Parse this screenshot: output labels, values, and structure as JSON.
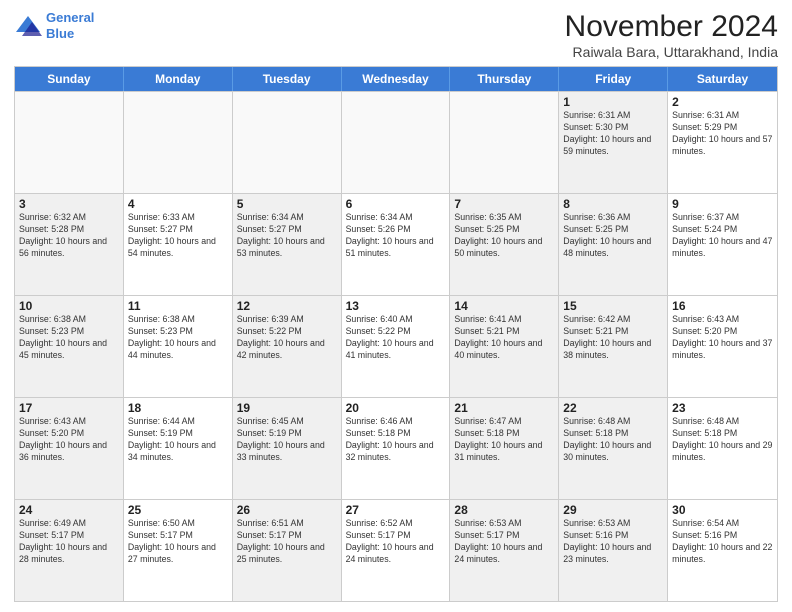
{
  "header": {
    "logo_line1": "General",
    "logo_line2": "Blue",
    "month_title": "November 2024",
    "location": "Raiwala Bara, Uttarakhand, India"
  },
  "weekdays": [
    "Sunday",
    "Monday",
    "Tuesday",
    "Wednesday",
    "Thursday",
    "Friday",
    "Saturday"
  ],
  "weeks": [
    [
      {
        "day": "",
        "info": "",
        "empty": true
      },
      {
        "day": "",
        "info": "",
        "empty": true
      },
      {
        "day": "",
        "info": "",
        "empty": true
      },
      {
        "day": "",
        "info": "",
        "empty": true
      },
      {
        "day": "",
        "info": "",
        "empty": true
      },
      {
        "day": "1",
        "info": "Sunrise: 6:31 AM\nSunset: 5:30 PM\nDaylight: 10 hours and 59 minutes.",
        "shaded": true
      },
      {
        "day": "2",
        "info": "Sunrise: 6:31 AM\nSunset: 5:29 PM\nDaylight: 10 hours and 57 minutes."
      }
    ],
    [
      {
        "day": "3",
        "info": "Sunrise: 6:32 AM\nSunset: 5:28 PM\nDaylight: 10 hours and 56 minutes.",
        "shaded": true
      },
      {
        "day": "4",
        "info": "Sunrise: 6:33 AM\nSunset: 5:27 PM\nDaylight: 10 hours and 54 minutes."
      },
      {
        "day": "5",
        "info": "Sunrise: 6:34 AM\nSunset: 5:27 PM\nDaylight: 10 hours and 53 minutes.",
        "shaded": true
      },
      {
        "day": "6",
        "info": "Sunrise: 6:34 AM\nSunset: 5:26 PM\nDaylight: 10 hours and 51 minutes."
      },
      {
        "day": "7",
        "info": "Sunrise: 6:35 AM\nSunset: 5:25 PM\nDaylight: 10 hours and 50 minutes.",
        "shaded": true
      },
      {
        "day": "8",
        "info": "Sunrise: 6:36 AM\nSunset: 5:25 PM\nDaylight: 10 hours and 48 minutes.",
        "shaded": true
      },
      {
        "day": "9",
        "info": "Sunrise: 6:37 AM\nSunset: 5:24 PM\nDaylight: 10 hours and 47 minutes."
      }
    ],
    [
      {
        "day": "10",
        "info": "Sunrise: 6:38 AM\nSunset: 5:23 PM\nDaylight: 10 hours and 45 minutes.",
        "shaded": true
      },
      {
        "day": "11",
        "info": "Sunrise: 6:38 AM\nSunset: 5:23 PM\nDaylight: 10 hours and 44 minutes."
      },
      {
        "day": "12",
        "info": "Sunrise: 6:39 AM\nSunset: 5:22 PM\nDaylight: 10 hours and 42 minutes.",
        "shaded": true
      },
      {
        "day": "13",
        "info": "Sunrise: 6:40 AM\nSunset: 5:22 PM\nDaylight: 10 hours and 41 minutes."
      },
      {
        "day": "14",
        "info": "Sunrise: 6:41 AM\nSunset: 5:21 PM\nDaylight: 10 hours and 40 minutes.",
        "shaded": true
      },
      {
        "day": "15",
        "info": "Sunrise: 6:42 AM\nSunset: 5:21 PM\nDaylight: 10 hours and 38 minutes.",
        "shaded": true
      },
      {
        "day": "16",
        "info": "Sunrise: 6:43 AM\nSunset: 5:20 PM\nDaylight: 10 hours and 37 minutes."
      }
    ],
    [
      {
        "day": "17",
        "info": "Sunrise: 6:43 AM\nSunset: 5:20 PM\nDaylight: 10 hours and 36 minutes.",
        "shaded": true
      },
      {
        "day": "18",
        "info": "Sunrise: 6:44 AM\nSunset: 5:19 PM\nDaylight: 10 hours and 34 minutes."
      },
      {
        "day": "19",
        "info": "Sunrise: 6:45 AM\nSunset: 5:19 PM\nDaylight: 10 hours and 33 minutes.",
        "shaded": true
      },
      {
        "day": "20",
        "info": "Sunrise: 6:46 AM\nSunset: 5:18 PM\nDaylight: 10 hours and 32 minutes."
      },
      {
        "day": "21",
        "info": "Sunrise: 6:47 AM\nSunset: 5:18 PM\nDaylight: 10 hours and 31 minutes.",
        "shaded": true
      },
      {
        "day": "22",
        "info": "Sunrise: 6:48 AM\nSunset: 5:18 PM\nDaylight: 10 hours and 30 minutes.",
        "shaded": true
      },
      {
        "day": "23",
        "info": "Sunrise: 6:48 AM\nSunset: 5:18 PM\nDaylight: 10 hours and 29 minutes."
      }
    ],
    [
      {
        "day": "24",
        "info": "Sunrise: 6:49 AM\nSunset: 5:17 PM\nDaylight: 10 hours and 28 minutes.",
        "shaded": true
      },
      {
        "day": "25",
        "info": "Sunrise: 6:50 AM\nSunset: 5:17 PM\nDaylight: 10 hours and 27 minutes."
      },
      {
        "day": "26",
        "info": "Sunrise: 6:51 AM\nSunset: 5:17 PM\nDaylight: 10 hours and 25 minutes.",
        "shaded": true
      },
      {
        "day": "27",
        "info": "Sunrise: 6:52 AM\nSunset: 5:17 PM\nDaylight: 10 hours and 24 minutes."
      },
      {
        "day": "28",
        "info": "Sunrise: 6:53 AM\nSunset: 5:17 PM\nDaylight: 10 hours and 24 minutes.",
        "shaded": true
      },
      {
        "day": "29",
        "info": "Sunrise: 6:53 AM\nSunset: 5:16 PM\nDaylight: 10 hours and 23 minutes.",
        "shaded": true
      },
      {
        "day": "30",
        "info": "Sunrise: 6:54 AM\nSunset: 5:16 PM\nDaylight: 10 hours and 22 minutes."
      }
    ]
  ]
}
